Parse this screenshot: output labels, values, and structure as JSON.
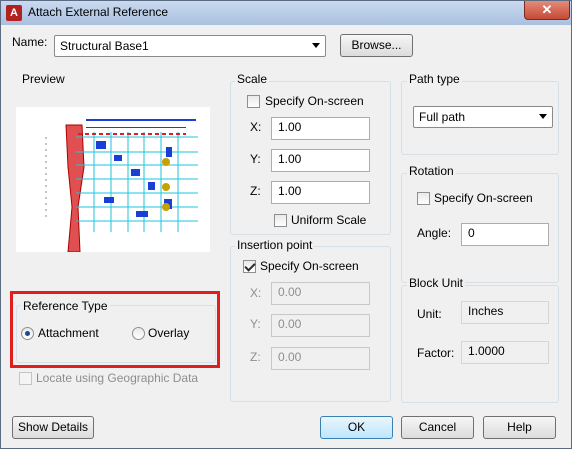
{
  "window": {
    "title": "Attach External Reference",
    "close_symbol": "✕",
    "app_icon_glyph": "A"
  },
  "name_row": {
    "label": "Name:",
    "value": "Structural Base1",
    "browse_label": "Browse..."
  },
  "preview": {
    "label": "Preview"
  },
  "scale": {
    "label": "Scale",
    "specify_label": "Specify On-screen",
    "x_label": "X:",
    "x_value": "1.00",
    "y_label": "Y:",
    "y_value": "1.00",
    "z_label": "Z:",
    "z_value": "1.00",
    "uniform_label": "Uniform Scale"
  },
  "insertion": {
    "label": "Insertion point",
    "specify_label": "Specify On-screen",
    "x_label": "X:",
    "x_value": "0.00",
    "y_label": "Y:",
    "y_value": "0.00",
    "z_label": "Z:",
    "z_value": "0.00"
  },
  "path_type": {
    "label": "Path type",
    "value": "Full path"
  },
  "rotation": {
    "label": "Rotation",
    "specify_label": "Specify On-screen",
    "angle_label": "Angle:",
    "angle_value": "0"
  },
  "block_unit": {
    "label": "Block Unit",
    "unit_label": "Unit:",
    "unit_value": "Inches",
    "factor_label": "Factor:",
    "factor_value": "1.0000"
  },
  "reference_type": {
    "label": "Reference Type",
    "attachment_label": "Attachment",
    "overlay_label": "Overlay",
    "selected": "Attachment"
  },
  "geo": {
    "label": "Locate using Geographic Data"
  },
  "buttons": {
    "show_details": "Show Details",
    "ok": "OK",
    "cancel": "Cancel",
    "help": "Help"
  },
  "colors": {
    "highlight": "#e01e1e",
    "title_bar": "#b9cde9",
    "accent_blue": "#3c7fb1"
  }
}
